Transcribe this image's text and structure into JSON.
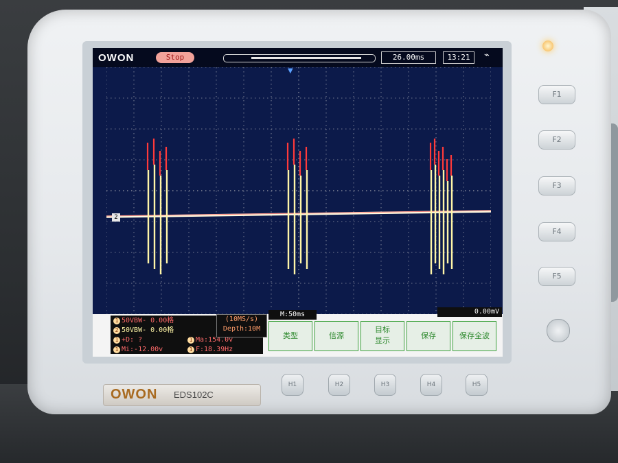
{
  "screen": {
    "logo": "OWON",
    "status": "Stop",
    "time_base_readout": "26.00ms",
    "clock": "13:21",
    "ch2_marker": "2"
  },
  "info": {
    "ch1_line": "50VBW-   0.00格",
    "ch2_line": "50VBW-   0.00格",
    "delta_line": "+D:  ?",
    "min_line": "Mi:-12.00v",
    "max_line": "Ma:154.0v",
    "freq_line": "F:18.39Hz",
    "sample_rate": "(10MS/s)",
    "depth": "Depth:10M",
    "m_tag": "M:50ms",
    "trig_level": "0.00mV"
  },
  "softkeys": [
    "类型",
    "信源",
    "目标\n显示",
    "保存",
    "保存全波"
  ],
  "front_buttons": {
    "f": [
      "F1",
      "F2",
      "F3",
      "F4",
      "F5"
    ],
    "h": [
      "H1",
      "H2",
      "H3",
      "H4",
      "H5"
    ]
  },
  "brand": {
    "logo": "OWON",
    "model": "EDS102C"
  },
  "colors": {
    "screen_bg": "#0c1a4a",
    "grid": "#c8c8c8",
    "trace_yellow": "#fff6a8",
    "trace_red": "#ff3a3a",
    "baseline": "#fff9e0"
  },
  "chart_data": {
    "type": "line",
    "divisions": {
      "x": 14,
      "y": 8
    },
    "bursts": [
      {
        "center_div": 1.5,
        "pulses": 4
      },
      {
        "center_div": 6.6,
        "pulses": 4
      },
      {
        "center_div": 11.8,
        "pulses": 6
      }
    ],
    "baseline_div": 4.8,
    "grid": true
  }
}
